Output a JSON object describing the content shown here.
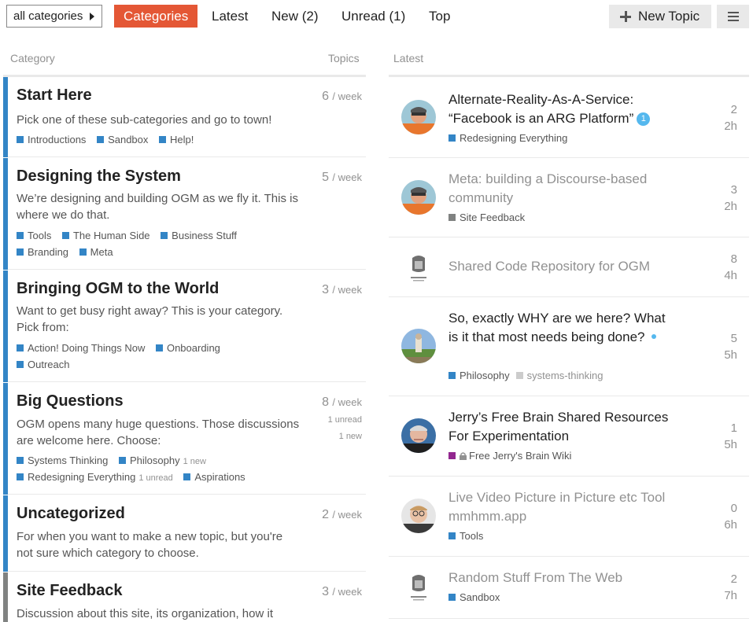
{
  "nav": {
    "category_dropdown": "all categories",
    "tabs": [
      {
        "label": "Categories",
        "active": true
      },
      {
        "label": "Latest",
        "active": false
      },
      {
        "label": "New (2)",
        "active": false
      },
      {
        "label": "Unread (1)",
        "active": false
      },
      {
        "label": "Top",
        "active": false
      }
    ],
    "new_topic_label": "New Topic",
    "menu_icon": "hamburger-icon"
  },
  "columns": {
    "category": "Category",
    "topics": "Topics",
    "latest": "Latest"
  },
  "colors": {
    "brand": "#e45735",
    "category_blue": "#3385c6",
    "category_gray": "#808281",
    "category_purple": "#92278f",
    "badge_blue": "#55b8ee",
    "tag_gray": "#cccccc"
  },
  "categories": [
    {
      "name": "Start Here",
      "count": "6",
      "per": "/ week",
      "description": "Pick one of these sub-categories and go to town!",
      "subcategories": [
        [
          {
            "label": "Introductions"
          },
          {
            "label": "Sandbox"
          },
          {
            "label": "Help!"
          }
        ]
      ]
    },
    {
      "name": "Designing the System",
      "count": "5",
      "per": "/ week",
      "description": "We’re designing and building OGM as we fly it. This is where we do that.",
      "subcategories": [
        [
          {
            "label": "Tools"
          },
          {
            "label": "The Human Side"
          },
          {
            "label": "Business Stuff"
          }
        ],
        [
          {
            "label": "Branding"
          },
          {
            "label": "Meta"
          }
        ]
      ]
    },
    {
      "name": "Bringing OGM to the World",
      "count": "3",
      "per": "/ week",
      "description": "Want to get busy right away? This is your category. Pick from:",
      "subcategories": [
        [
          {
            "label": "Action! Doing Things Now"
          },
          {
            "label": "Onboarding"
          }
        ],
        [
          {
            "label": "Outreach"
          }
        ]
      ]
    },
    {
      "name": "Big Questions",
      "count": "8",
      "per": "/ week",
      "extra": [
        "1 unread",
        "1 new"
      ],
      "description": "OGM opens many huge questions. Those discussions are welcome here. Choose:",
      "subcategories": [
        [
          {
            "label": "Systems Thinking"
          },
          {
            "label": "Philosophy",
            "meta": "1 new"
          }
        ],
        [
          {
            "label": "Redesigning Everything",
            "meta": "1 unread"
          },
          {
            "label": "Aspirations"
          }
        ]
      ]
    },
    {
      "name": "Uncategorized",
      "count": "2",
      "per": "/ week",
      "description": "For when you want to make a new topic, but you're not sure which category to choose.",
      "subcategories": []
    },
    {
      "name": "Site Feedback",
      "count": "3",
      "per": "/ week",
      "description": "Discussion about this site, its organization, how it",
      "subcategories": []
    }
  ],
  "topics": [
    {
      "title": "Alternate-Reality-As-A-Service: “Facebook is an ARG Platform”",
      "unread_badge": "1",
      "category": "Redesigning Everything",
      "posts": "2",
      "age": "2h",
      "avatar": "avatar-orange"
    },
    {
      "title": "Meta: building a Discourse-based community",
      "category": "Site Feedback",
      "posts": "3",
      "age": "2h",
      "avatar": "avatar-orange"
    },
    {
      "title": "Shared Code Repository for OGM",
      "category": "",
      "posts": "8",
      "age": "4h",
      "avatar": "avatar-sketch"
    },
    {
      "title": "So, exactly WHY are we here? What is it that most needs being done?",
      "category": "Philosophy",
      "tag": "systems-thinking",
      "posts": "5",
      "age": "5h",
      "avatar": "avatar-outdoor"
    },
    {
      "title": "Jerry’s Free Brain Shared Resources For Experimentation",
      "category": "Free Jerry's Brain Wiki",
      "posts": "1",
      "age": "5h",
      "avatar": "avatar-man"
    },
    {
      "title": "Live Video Picture in Picture etc Tool mmhmm.app",
      "category": "Tools",
      "posts": "0",
      "age": "6h",
      "avatar": "avatar-glasses"
    },
    {
      "title": "Random Stuff From The Web",
      "category": "Sandbox",
      "posts": "2",
      "age": "7h",
      "avatar": "avatar-sketch"
    }
  ]
}
